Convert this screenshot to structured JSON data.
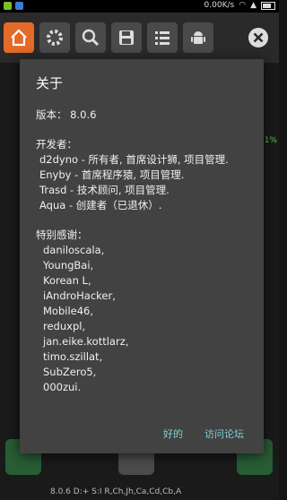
{
  "status_bar": {
    "speed": "0.00K/s"
  },
  "background": {
    "percent": "81%",
    "status_line": "8.0.6   D:+   S:I   R,Ch,Jh,Ca,Cd,Cb,A"
  },
  "dialog": {
    "title": "关于",
    "version": "版本： 8.0.6",
    "developers_header": "开发者：",
    "developers": [
      "d2dyno - 所有者, 首席设计狮, 项目管理.",
      "Enyby - 首席程序猿, 项目管理.",
      "Trasd - 技术顾问, 项目管理.",
      "Aqua - 创建者（已退休）."
    ],
    "thanks_header": "特别感谢：",
    "thanks": [
      "daniloscala,",
      "YoungBai,",
      "Korean L,",
      "iAndroHacker,",
      "Mobile46,",
      "reduxpl,",
      "jan.eike.kottlarz,",
      "timo.szillat,",
      "SubZero5,",
      "000zui."
    ],
    "ok_label": "好的",
    "forum_label": "访问论坛"
  },
  "colors": {
    "accent": "#e46a2a",
    "link": "#7fd0dc",
    "dialog_bg": "#424242"
  },
  "toolbar_icons": [
    "home-icon",
    "settings-icon",
    "search-icon",
    "save-icon",
    "list-icon",
    "android-icon",
    "close-icon"
  ]
}
